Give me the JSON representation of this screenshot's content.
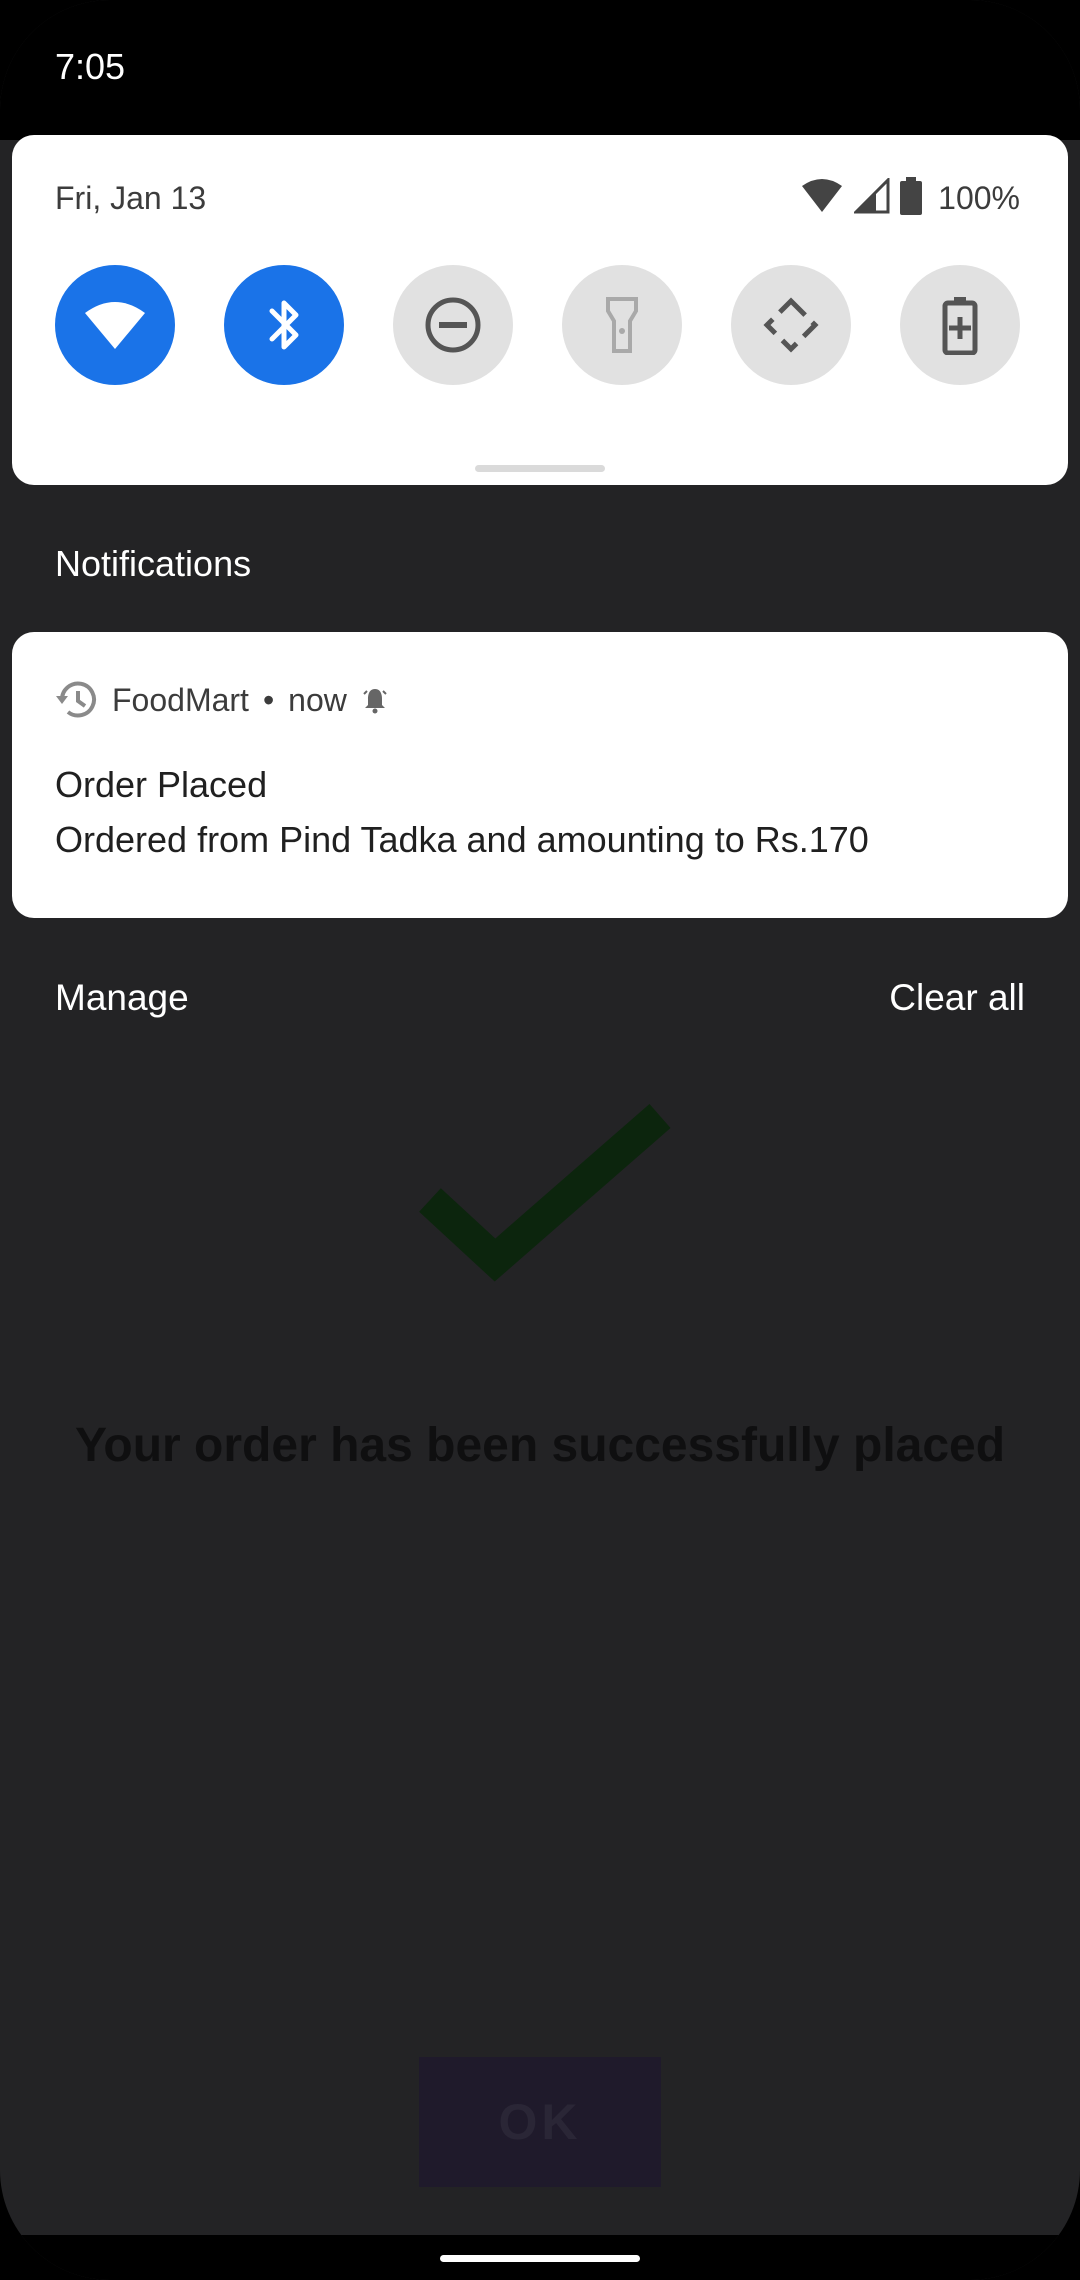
{
  "status_bar": {
    "time": "7:05"
  },
  "quick_settings": {
    "date": "Fri, Jan 13",
    "battery_percent": "100%",
    "tiles": [
      {
        "name": "wifi",
        "state": "on"
      },
      {
        "name": "bluetooth",
        "state": "on"
      },
      {
        "name": "do-not-disturb",
        "state": "off"
      },
      {
        "name": "flashlight",
        "state": "off"
      },
      {
        "name": "auto-rotate",
        "state": "off"
      },
      {
        "name": "battery-saver",
        "state": "off"
      }
    ],
    "accent_color": "#1a73e8"
  },
  "notifications": {
    "header": "Notifications",
    "items": [
      {
        "app": "FoodMart",
        "separator": "•",
        "time": "now",
        "title": "Order Placed",
        "text": "Ordered from Pind Tadka and amounting to Rs.170"
      }
    ],
    "manage_label": "Manage",
    "clear_all_label": "Clear all"
  },
  "app": {
    "message": "Your order has been successfully placed",
    "ok_label": "OK"
  }
}
